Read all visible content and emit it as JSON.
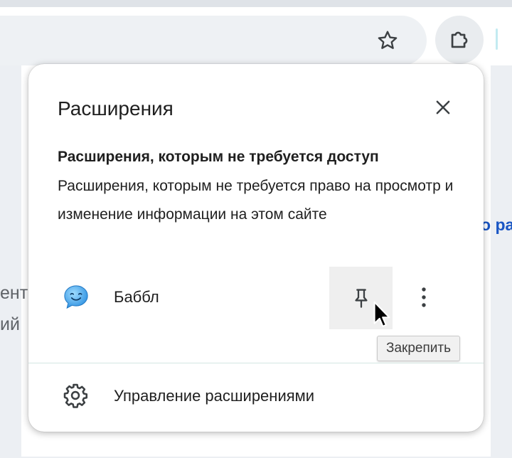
{
  "toolbar": {
    "bookmark_icon": "star-icon",
    "extensions_icon": "puzzle-piece-icon"
  },
  "background": {
    "left_line_1": "ент",
    "left_line_2": "ий",
    "right_link": "о ра"
  },
  "popup": {
    "title": "Расширения",
    "close_icon": "close-icon",
    "section_heading": "Расширения, которым не требуется доступ",
    "section_description": "Расширения, которым не требуется право на просмотр и изменение информации на этом сайте",
    "extensions": [
      {
        "name": "Баббл",
        "icon": "smiley-speech-bubble-icon",
        "pin_icon": "pin-icon",
        "menu_icon": "more-vertical-icon"
      }
    ],
    "tooltip": "Закрепить",
    "manage_label": "Управление расширениями",
    "manage_icon": "gear-icon"
  },
  "colors": {
    "link_blue": "#1a56c4",
    "extension_icon_blue": "#3aa3f0",
    "popup_background": "#ffffff"
  }
}
